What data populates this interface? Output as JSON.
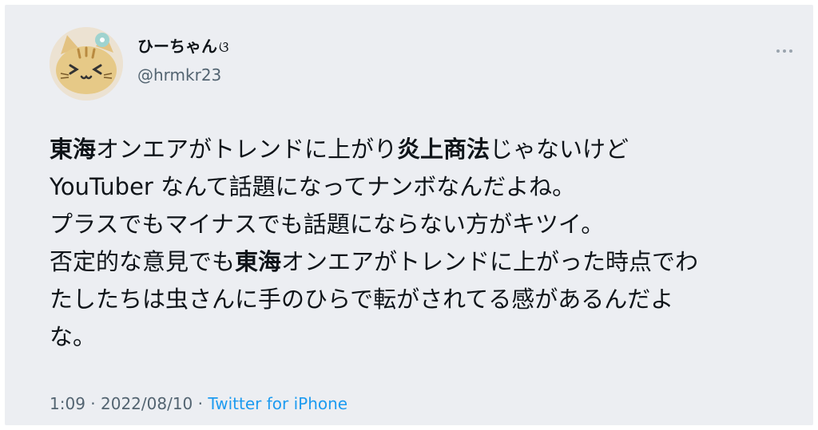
{
  "author": {
    "display_name": "ひーちゃん",
    "name_emoji": "ଓ",
    "handle": "@hrmkr23"
  },
  "tweet": {
    "lines": [
      [
        {
          "t": "東海",
          "b": true
        },
        {
          "t": "オンエアがトレンドに上がり",
          "b": false
        },
        {
          "t": "炎上商法",
          "b": true
        },
        {
          "t": "じゃないけど",
          "b": false
        }
      ],
      [
        {
          "t": "YouTuber なんて話題になってナンボなんだよね。",
          "b": false
        }
      ],
      [
        {
          "t": "プラスでもマイナスでも話題にならない方がキツイ。",
          "b": false
        }
      ],
      [
        {
          "t": "否定的な意見でも",
          "b": false
        },
        {
          "t": "東海",
          "b": true
        },
        {
          "t": "オンエアがトレンドに上がった時点でわ",
          "b": false
        }
      ],
      [
        {
          "t": "たしたちは虫さんに手のひらで転がされてる感があるんだよ",
          "b": false
        }
      ],
      [
        {
          "t": "な。",
          "b": false
        }
      ]
    ]
  },
  "meta": {
    "time": "1:09",
    "sep1": " · ",
    "date": "2022/08/10",
    "sep2": " · ",
    "source": "Twitter for iPhone"
  },
  "icons": {
    "avatar": "cat-avatar-image",
    "more": "more-options-icon"
  },
  "colors": {
    "background": "#eceef2",
    "text": "#0f1419",
    "secondary": "#536471",
    "link": "#1d9bf0"
  }
}
